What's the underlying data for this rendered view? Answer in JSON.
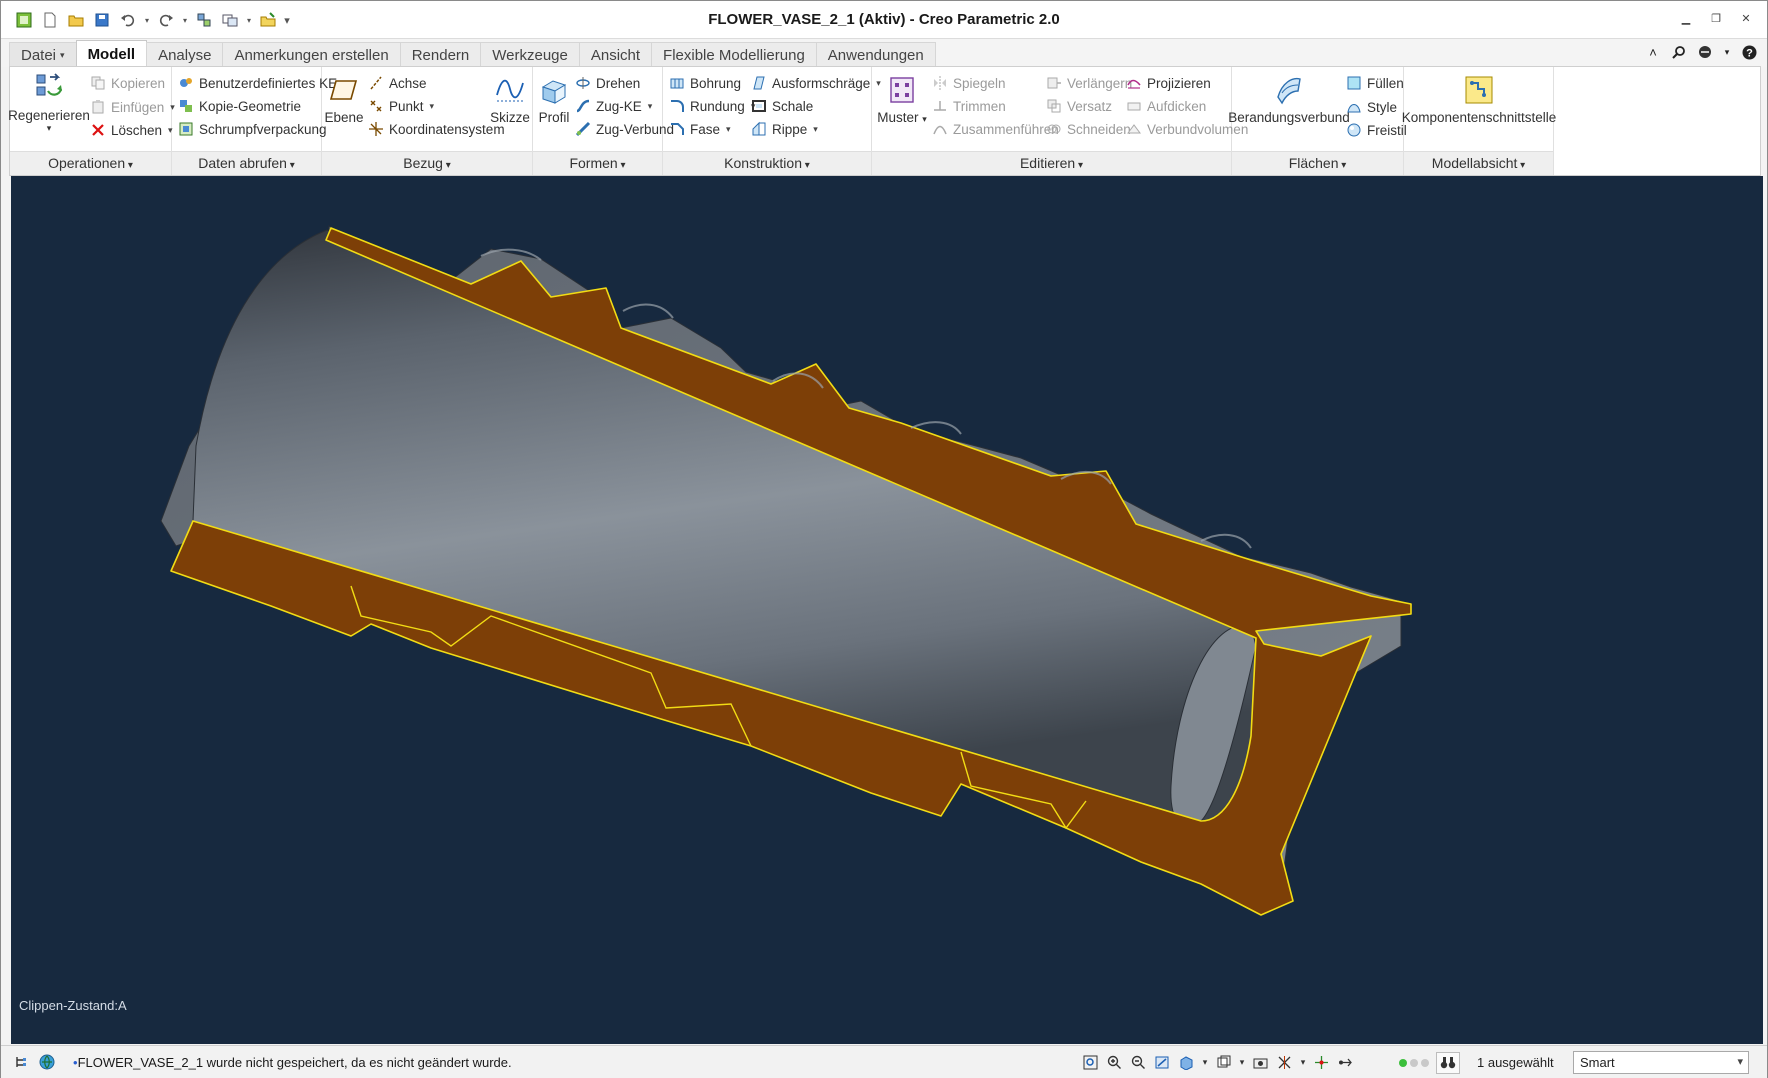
{
  "window": {
    "title": "FLOWER_VASE_2_1 (Aktiv) - Creo Parametric 2.0"
  },
  "tabs": [
    {
      "label": "Datei"
    },
    {
      "label": "Modell"
    },
    {
      "label": "Analyse"
    },
    {
      "label": "Anmerkungen erstellen"
    },
    {
      "label": "Rendern"
    },
    {
      "label": "Werkzeuge"
    },
    {
      "label": "Ansicht"
    },
    {
      "label": "Flexible Modellierung"
    },
    {
      "label": "Anwendungen"
    }
  ],
  "ribbon": {
    "operationen": {
      "label": "Operationen",
      "regenerieren": "Regenerieren",
      "kopieren": "Kopieren",
      "einfuegen": "Einfügen",
      "loeschen": "Löschen"
    },
    "daten": {
      "label": "Daten abrufen",
      "benutzer": "Benutzerdefiniertes KE",
      "kopie": "Kopie-Geometrie",
      "schrumpf": "Schrumpfverpackung"
    },
    "bezug": {
      "label": "Bezug",
      "ebene": "Ebene",
      "achse": "Achse",
      "punkt": "Punkt",
      "koord": "Koordinatensystem",
      "skizze": "Skizze"
    },
    "formen": {
      "label": "Formen",
      "profil": "Profil",
      "drehen": "Drehen",
      "zugke": "Zug-KE",
      "zugverbund": "Zug-Verbund"
    },
    "konstruktion": {
      "label": "Konstruktion",
      "bohrung": "Bohrung",
      "rundung": "Rundung",
      "fase": "Fase",
      "ausform": "Ausformschräge",
      "schale": "Schale",
      "rippe": "Rippe"
    },
    "editieren": {
      "label": "Editieren",
      "muster": "Muster",
      "spiegeln": "Spiegeln",
      "trimmen": "Trimmen",
      "zusammen": "Zusammenführen",
      "verlaengern": "Verlängern",
      "versatz": "Versatz",
      "schneiden": "Schneiden",
      "projizieren": "Projizieren",
      "aufdicken": "Aufdicken",
      "verbundvol": "Verbundvolumen"
    },
    "flaechen": {
      "label": "Flächen",
      "berandung": "Berandungsverbund",
      "fuellen": "Füllen",
      "style": "Style",
      "freistil": "Freistil"
    },
    "modellabsicht": {
      "label": "Modellabsicht",
      "komponenten": "Komponentenschnittstelle"
    }
  },
  "viewport": {
    "clip_state": "Clippen-Zustand:A",
    "background": "#17293f",
    "section_color": "#7d3f07",
    "edge_color": "#f2dc14"
  },
  "statusbar": {
    "message": "FLOWER_VASE_2_1 wurde nicht gespeichert, da es nicht geändert wurde.",
    "selected": "1 ausgewählt",
    "filter": "Smart"
  }
}
